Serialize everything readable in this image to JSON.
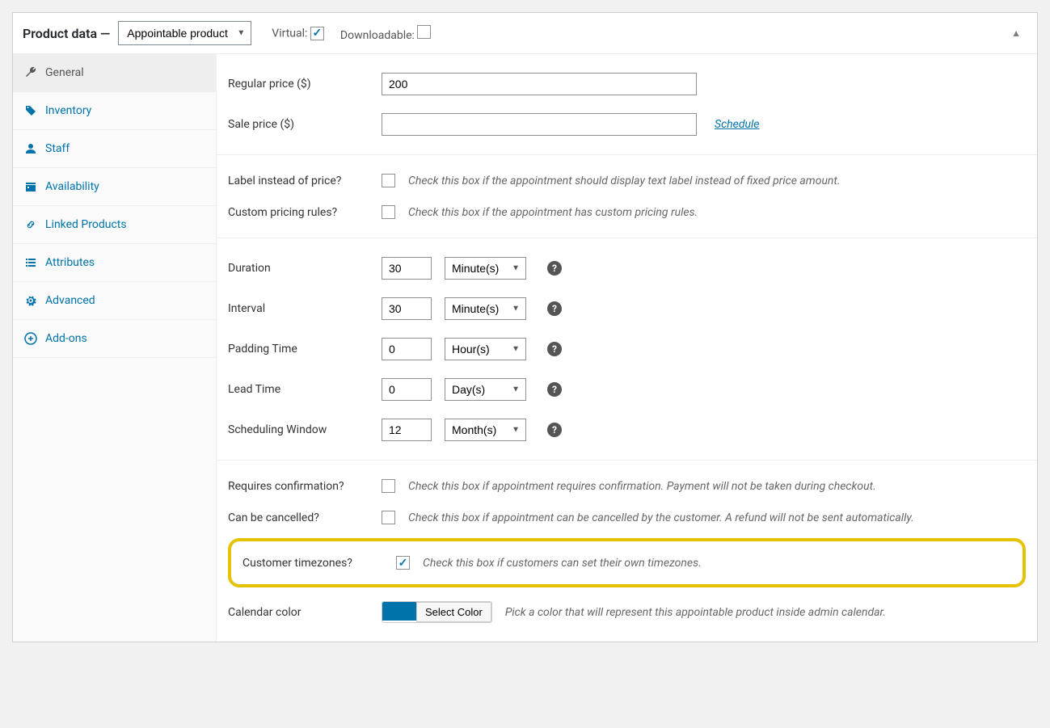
{
  "header": {
    "title": "Product data —",
    "product_type": "Appointable product",
    "virtual_label": "Virtual:",
    "virtual_checked": true,
    "downloadable_label": "Downloadable:",
    "downloadable_checked": false
  },
  "sidebar": {
    "items": [
      {
        "label": "General",
        "icon": "wrench",
        "active": true
      },
      {
        "label": "Inventory",
        "icon": "tag",
        "active": false
      },
      {
        "label": "Staff",
        "icon": "person",
        "active": false
      },
      {
        "label": "Availability",
        "icon": "calendar",
        "active": false
      },
      {
        "label": "Linked Products",
        "icon": "link",
        "active": false
      },
      {
        "label": "Attributes",
        "icon": "list",
        "active": false
      },
      {
        "label": "Advanced",
        "icon": "gear",
        "active": false
      },
      {
        "label": "Add-ons",
        "icon": "plus",
        "active": false
      }
    ]
  },
  "pricing": {
    "regular_price_label": "Regular price ($)",
    "regular_price_value": "200",
    "sale_price_label": "Sale price ($)",
    "sale_price_value": "",
    "schedule_link": "Schedule"
  },
  "price_options": {
    "label_instead_label": "Label instead of price?",
    "label_instead_hint": "Check this box if the appointment should display text label instead of fixed price amount.",
    "custom_pricing_label": "Custom pricing rules?",
    "custom_pricing_hint": "Check this box if the appointment has custom pricing rules."
  },
  "duration": {
    "duration_label": "Duration",
    "duration_value": "30",
    "duration_unit": "Minute(s)",
    "interval_label": "Interval",
    "interval_value": "30",
    "interval_unit": "Minute(s)",
    "padding_label": "Padding Time",
    "padding_value": "0",
    "padding_unit": "Hour(s)",
    "lead_label": "Lead Time",
    "lead_value": "0",
    "lead_unit": "Day(s)",
    "window_label": "Scheduling Window",
    "window_value": "12",
    "window_unit": "Month(s)"
  },
  "confirmation": {
    "requires_label": "Requires confirmation?",
    "requires_hint": "Check this box if appointment requires confirmation. Payment will not be taken during checkout.",
    "cancel_label": "Can be cancelled?",
    "cancel_hint": "Check this box if appointment can be cancelled by the customer. A refund will not be sent automatically.",
    "timezone_label": "Customer timezones?",
    "timezone_hint": "Check this box if customers can set their own timezones."
  },
  "calendar": {
    "color_label": "Calendar color",
    "select_color_btn": "Select Color",
    "color_value": "#0073aa",
    "color_hint": "Pick a color that will represent this appointable product inside admin calendar."
  }
}
